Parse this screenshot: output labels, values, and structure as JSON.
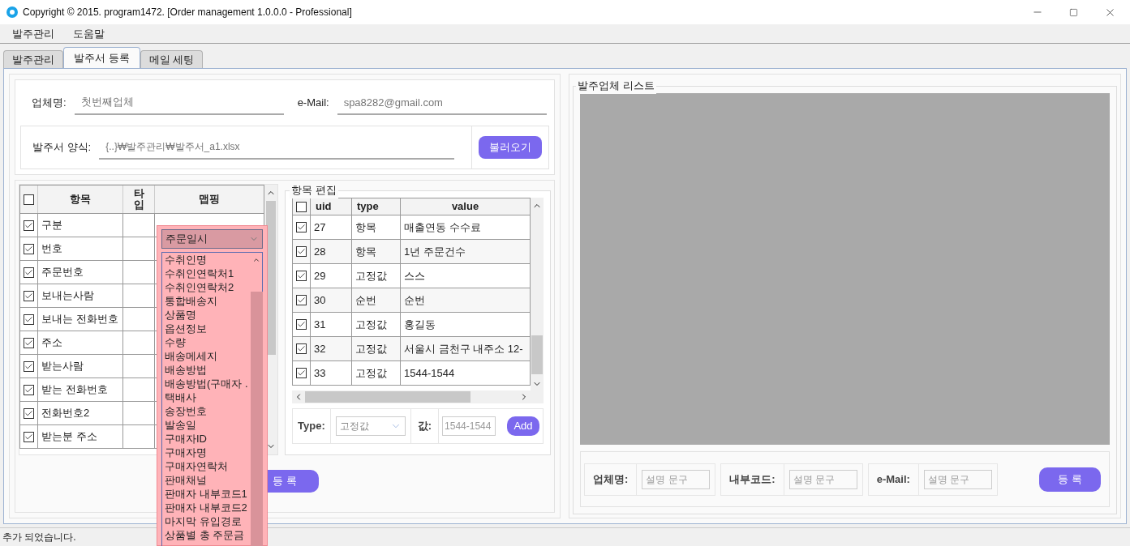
{
  "window": {
    "title": "Copyright © 2015. program1472. [Order management 1.0.0.0 - Professional]"
  },
  "menu": [
    "발주관리",
    "도움말"
  ],
  "tabs": [
    {
      "label": "발주관리",
      "selected": false
    },
    {
      "label": "발주서 등록",
      "selected": true
    },
    {
      "label": "메일 세팅",
      "selected": false
    }
  ],
  "company": {
    "name_label": "업체명:",
    "name_value": "첫번째업체",
    "email_label": "e-Mail:",
    "email_value": "spa8282@gmail.com"
  },
  "template": {
    "label": "발주서 양식:",
    "value": "{..}₩발주관리₩발주서_a1.xlsx",
    "button": "불러오기"
  },
  "mapping_grid": {
    "columns": [
      "항목",
      "타입",
      "맵핑"
    ],
    "header_checked": false,
    "rows": [
      {
        "item": "구분",
        "checked": true
      },
      {
        "item": "번호",
        "checked": true
      },
      {
        "item": "주문번호",
        "checked": true
      },
      {
        "item": "보내는사람",
        "checked": true
      },
      {
        "item": "보내는 전화번호",
        "checked": true
      },
      {
        "item": "주소",
        "checked": true
      },
      {
        "item": "받는사람",
        "checked": true
      },
      {
        "item": "받는 전화번호",
        "checked": true
      },
      {
        "item": "전화번호2",
        "checked": true
      },
      {
        "item": "받는분 주소",
        "checked": true
      }
    ]
  },
  "mapping_dropdown": {
    "value": "주문일시",
    "options": [
      "수취인명",
      "수취인연락처1",
      "수취인연락처2",
      "통합배송지",
      "상품명",
      "옵션정보",
      "수량",
      "배송메세지",
      "배송방법",
      "배송방법(구매자 .",
      "택배사",
      "송장번호",
      "발송일",
      "구매자ID",
      "구매자명",
      "구매자연락처",
      "판매채널",
      "판매자 내부코드1",
      "판매자 내부코드2",
      "마지막 유입경로",
      "상품별 총 주문금"
    ]
  },
  "register_button": "등 록",
  "item_edit": {
    "title": "항목 편집",
    "columns": [
      "uid",
      "type",
      "value"
    ],
    "header_checked": false,
    "rows": [
      {
        "uid": "27",
        "type": "항목",
        "value": "매출연동 수수료",
        "checked": true
      },
      {
        "uid": "28",
        "type": "항목",
        "value": "1년 주문건수",
        "checked": true
      },
      {
        "uid": "29",
        "type": "고정값",
        "value": "스스",
        "checked": true
      },
      {
        "uid": "30",
        "type": "순번",
        "value": "순번",
        "checked": true
      },
      {
        "uid": "31",
        "type": "고정값",
        "value": "홍길동",
        "checked": true
      },
      {
        "uid": "32",
        "type": "고정값",
        "value": "서울시 금천구 내주소 12-",
        "checked": true
      },
      {
        "uid": "33",
        "type": "고정값",
        "value": "1544-1544",
        "checked": true
      }
    ],
    "type_label": "Type:",
    "type_value": "고정값",
    "value_label": "값:",
    "value_placeholder": "1544-1544",
    "button": "Add"
  },
  "vendor_list": {
    "title": "발주업체 리스트",
    "fields": [
      {
        "label": "업체명:",
        "placeholder": "설명 문구"
      },
      {
        "label": "내부코드:",
        "placeholder": "설명 문구"
      },
      {
        "label": "e-Mail:",
        "placeholder": "설명 문구"
      }
    ],
    "button": "등 록"
  },
  "status_bar": "추가 되었습니다."
}
